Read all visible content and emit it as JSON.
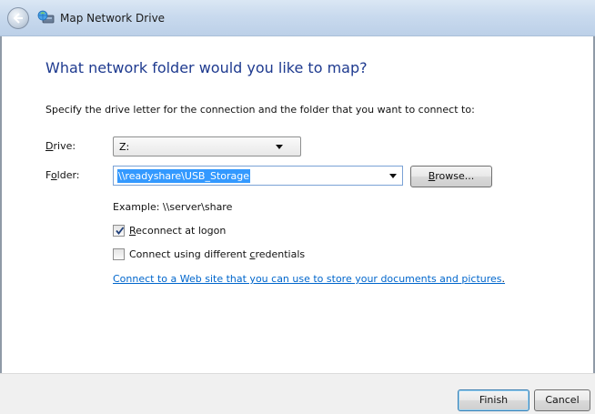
{
  "window": {
    "title": "Map Network Drive"
  },
  "content": {
    "heading": "What network folder would you like to map?",
    "instruction": "Specify the drive letter for the connection and the folder that you want to connect to:",
    "drive_label_underlined": "D",
    "drive_label_rest": "rive:",
    "drive_value": "Z:",
    "folder_label_first": "F",
    "folder_label_underlined": "o",
    "folder_label_rest": "lder:",
    "folder_value": "\\\\readyshare\\USB_Storage",
    "browse_underlined": "B",
    "browse_rest": "rowse...",
    "example": "Example: \\\\server\\share",
    "reconnect": {
      "checked": true,
      "underlined": "R",
      "rest": "econnect at logon"
    },
    "credentials": {
      "checked": false,
      "before": "Connect using different ",
      "underlined": "c",
      "after": "redentials"
    },
    "weblink_text": "Connect to a Web site that you can use to store your documents and pictures",
    "weblink_period": "."
  },
  "footer": {
    "finish_label": "Finish",
    "cancel_label": "Cancel"
  },
  "colors": {
    "heading": "#1e3a8f",
    "link": "#0066cc",
    "selection": "#3399ff"
  },
  "icons": {
    "back": "back-arrow-icon",
    "title": "network-drive-icon",
    "dropdown": "chevron-down-icon",
    "check": "checkmark-icon"
  }
}
